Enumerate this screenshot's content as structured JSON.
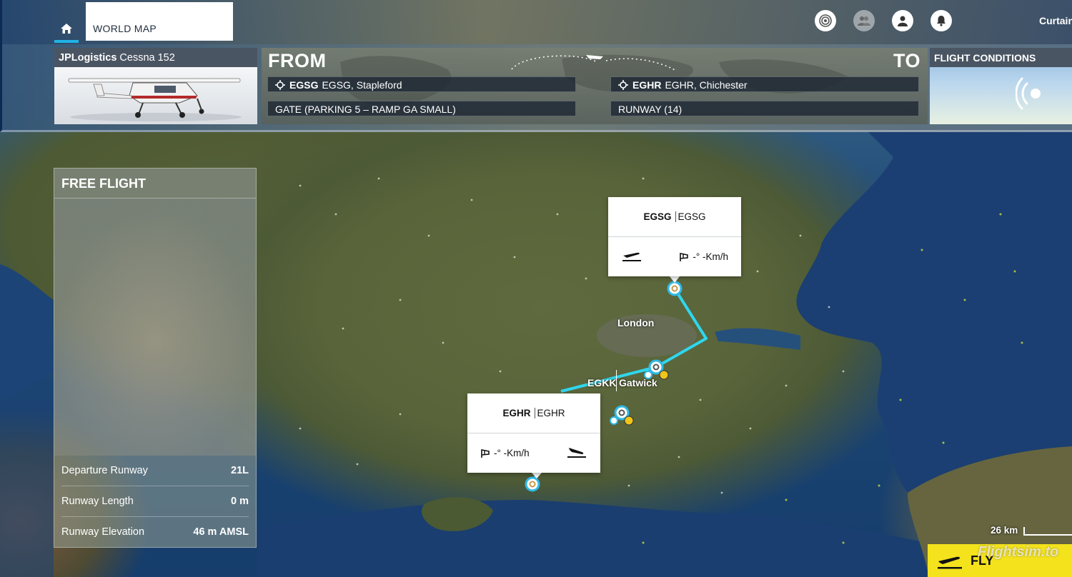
{
  "topbar": {
    "home_icon": "home-icon",
    "tab_label": "WORLD MAP",
    "icons": [
      "activity-icon",
      "multiplayer-icon",
      "profile-icon",
      "notifications-icon"
    ],
    "user_name": "Curtain"
  },
  "aircraft": {
    "brand": "JPLogistics",
    "model": "Cessna 152"
  },
  "route": {
    "from_label": "FROM",
    "to_label": "TO",
    "departure": {
      "icao": "EGSG",
      "name": "EGSG, Stapleford",
      "spawn": "GATE (PARKING 5 – RAMP GA SMALL)"
    },
    "arrival": {
      "icao": "EGHR",
      "name": "EGHR, Chichester",
      "spawn": "RUNWAY (14)"
    }
  },
  "conditions": {
    "title": "FLIGHT CONDITIONS",
    "icon": "weather-signal-icon"
  },
  "info_panel": {
    "title": "FREE FLIGHT",
    "stats": [
      {
        "label": "Departure Runway",
        "value": "21L"
      },
      {
        "label": "Runway Length",
        "value": "0 m"
      },
      {
        "label": "Runway Elevation",
        "value": "46 m AMSL"
      }
    ]
  },
  "map": {
    "egsg_card": {
      "code": "EGSG",
      "name": "EGSG",
      "wind": "-° -Km/h"
    },
    "eghr_card": {
      "code": "EGHR",
      "name": "EGHR",
      "wind": "-° -Km/h"
    },
    "city_label": "London",
    "waypoint_code": "EGKK",
    "waypoint_name": "Gatwick",
    "scale_label": "26 km",
    "route_color": "#2fd6ee"
  },
  "fly_button": {
    "label": "FLY"
  },
  "watermark": "Flightsim.to"
}
